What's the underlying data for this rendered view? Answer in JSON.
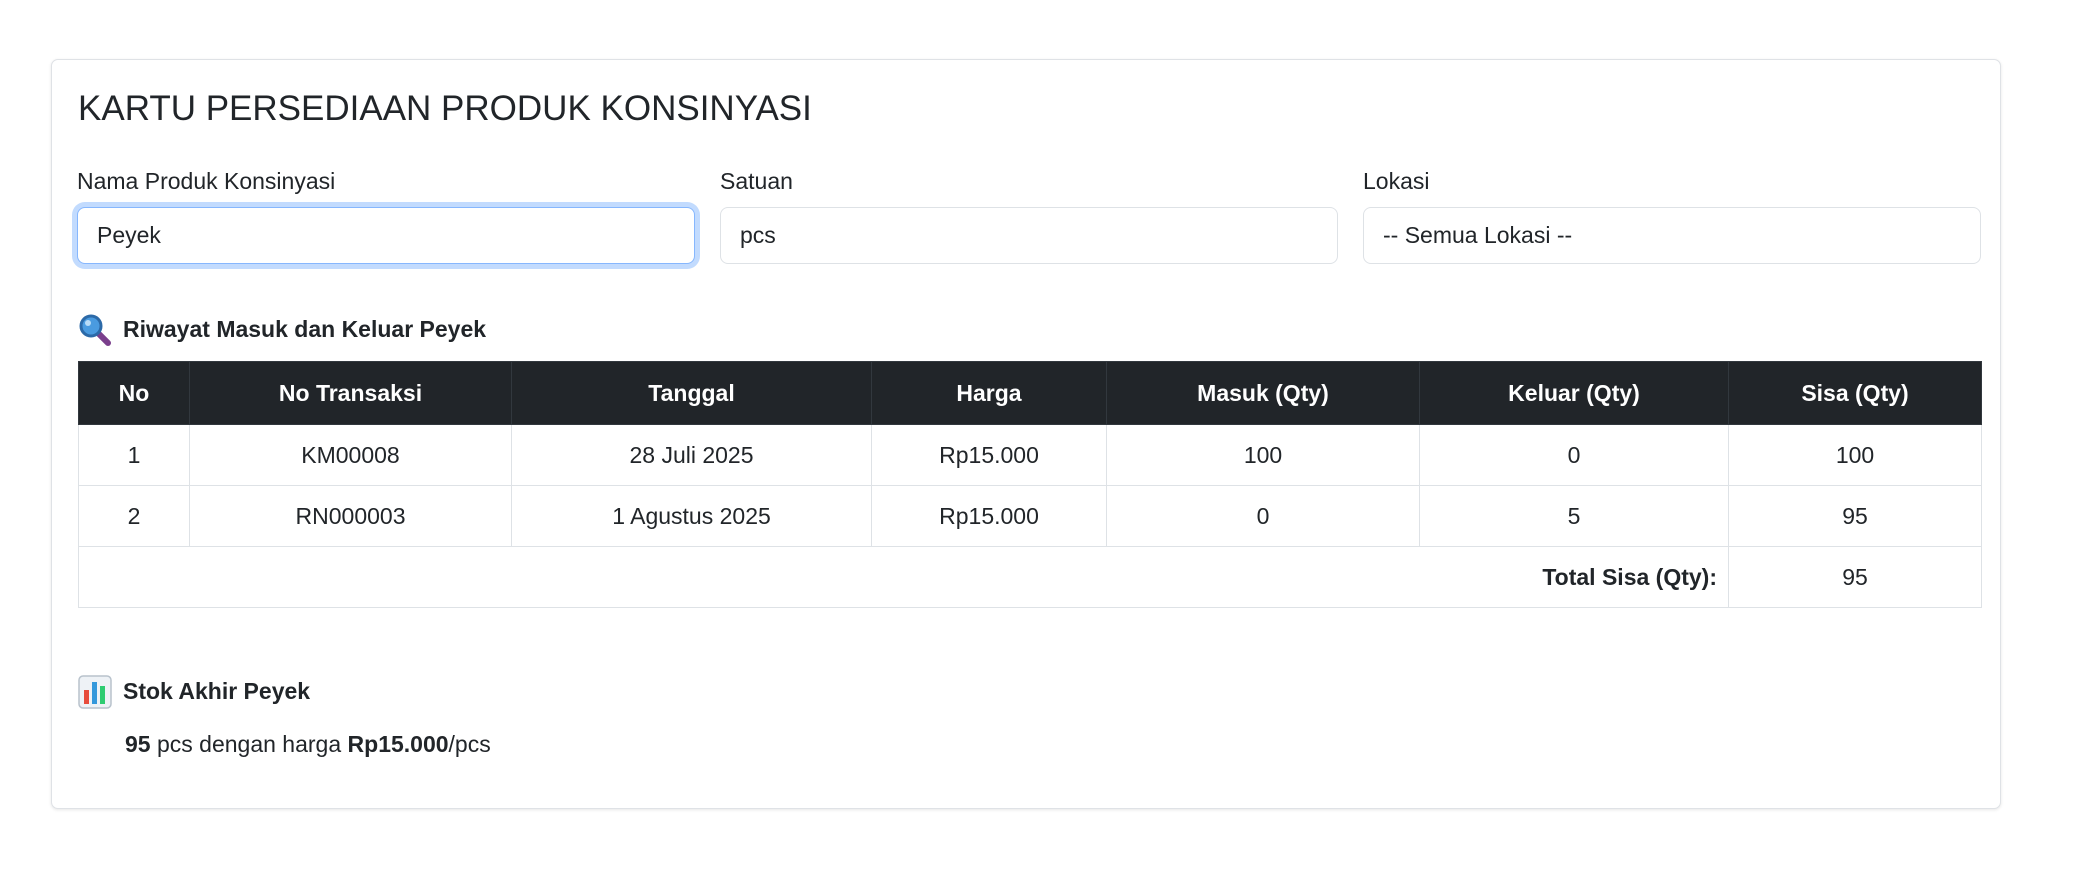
{
  "page_title": "KARTU PERSEDIAAN PRODUK KONSINYASI",
  "form": {
    "product": {
      "label": "Nama Produk Konsinyasi",
      "value": "Peyek"
    },
    "unit": {
      "label": "Satuan",
      "value": "pcs"
    },
    "location": {
      "label": "Lokasi",
      "selected": "-- Semua Lokasi --"
    }
  },
  "history": {
    "icon": "magnifier-icon",
    "heading": "Riwayat Masuk dan Keluar Peyek",
    "columns": [
      "No",
      "No Transaksi",
      "Tanggal",
      "Harga",
      "Masuk (Qty)",
      "Keluar (Qty)",
      "Sisa (Qty)"
    ],
    "rows": [
      {
        "no": "1",
        "transaction": "KM00008",
        "date": "28 Juli 2025",
        "price": "Rp15.000",
        "in": "100",
        "out": "0",
        "balance": "100"
      },
      {
        "no": "2",
        "transaction": "RN000003",
        "date": "1 Agustus 2025",
        "price": "Rp15.000",
        "in": "0",
        "out": "5",
        "balance": "95"
      }
    ],
    "total_label": "Total Sisa (Qty):",
    "total_value": "95"
  },
  "final_stock": {
    "icon": "bar-chart-icon",
    "heading": "Stok Akhir Peyek",
    "qty": "95",
    "text_middle": "pcs dengan harga",
    "price": "Rp15.000",
    "per_unit": "/pcs"
  },
  "colors": {
    "table_header_bg": "#212529",
    "focus_border": "#86b7fe",
    "border": "#dee2e6"
  }
}
